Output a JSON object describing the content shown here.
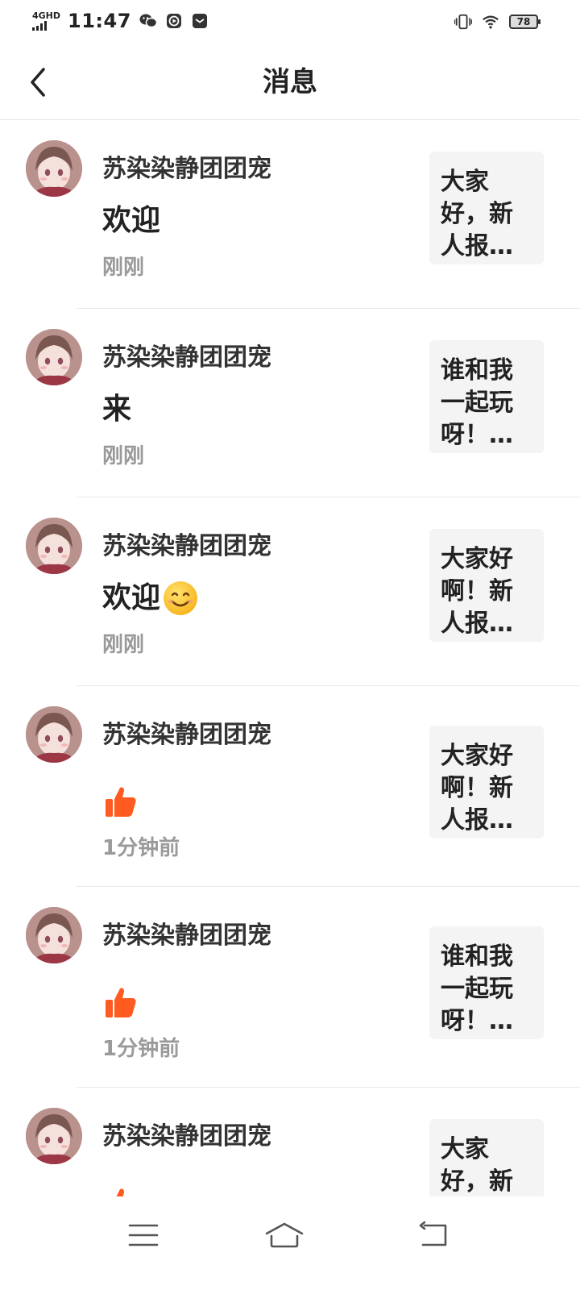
{
  "status": {
    "network": "4GHD",
    "time": "11:47",
    "battery": "78"
  },
  "header": {
    "title": "消息"
  },
  "items": [
    {
      "name": "苏染染静团团宠",
      "message": "欢迎",
      "message_type": "text",
      "time": "刚刚",
      "preview": [
        "大家",
        "好，新",
        "人报…"
      ]
    },
    {
      "name": "苏染染静团团宠",
      "message": "来",
      "message_type": "text",
      "time": "刚刚",
      "preview": [
        "谁和我",
        "一起玩",
        "呀！…"
      ]
    },
    {
      "name": "苏染染静团团宠",
      "message": "欢迎",
      "message_type": "text+smile-emoji",
      "time": "刚刚",
      "preview": [
        "大家好",
        "啊！新",
        "人报…"
      ]
    },
    {
      "name": "苏染染静团团宠",
      "message": "",
      "message_type": "thumbs-up-icon",
      "time": "1分钟前",
      "preview": [
        "大家好",
        "啊！新",
        "人报…"
      ]
    },
    {
      "name": "苏染染静团团宠",
      "message": "",
      "message_type": "thumbs-up-icon",
      "time": "1分钟前",
      "preview": [
        "谁和我",
        "一起玩",
        "呀！…"
      ]
    },
    {
      "name": "苏染染静团团宠",
      "message": "",
      "message_type": "thumbs-up-icon",
      "time": "",
      "preview": [
        "大家",
        "好，新",
        ""
      ]
    }
  ],
  "colors": {
    "like": "#FF5A1F",
    "secondary_text": "#9A9A9A",
    "preview_bg": "#F4F4F4"
  }
}
